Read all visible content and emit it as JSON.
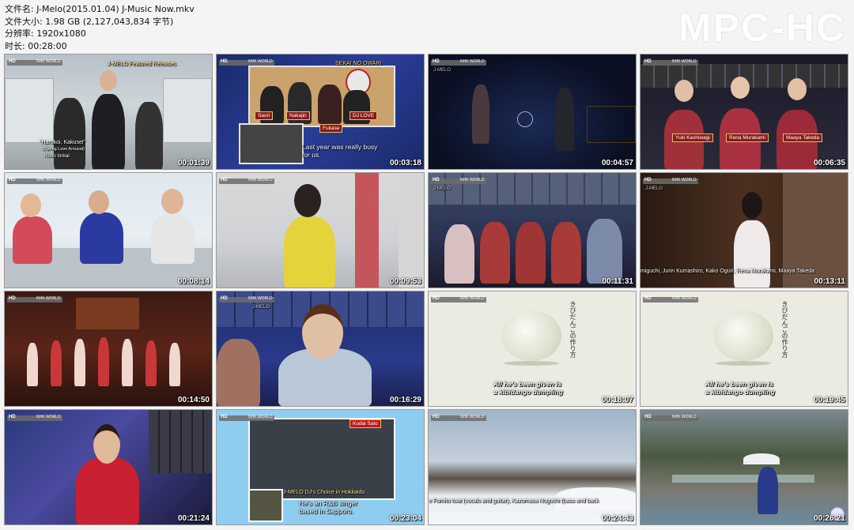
{
  "file_info": {
    "filename": "文件名: J-Melo(2015.01.04) J-Music Now.mkv",
    "filesize": "文件大小: 1.98 GB (2,127,043,834 字节)",
    "resolution": "分辨率: 1920x1080",
    "duration": "时长: 00:28:00"
  },
  "watermark": "MPC-HC",
  "thumbnails": [
    {
      "time": "00:01:39",
      "hd": "HD",
      "net": "NHK WORLD",
      "top_caption": "J-MELO Featured Releases",
      "captions": [
        "\"Harukoi, Kakusei\"",
        "(Spring Love Arousal)",
        "Kuso Iinkai"
      ]
    },
    {
      "time": "00:03:18",
      "hd": "HD",
      "net": "NHK WORLD",
      "top_caption": "SEKAI NO OWARI",
      "names": [
        "Saori",
        "Nakajin",
        "Fukase",
        "DJ LOVE"
      ],
      "captions": [
        "Last year was really busy",
        "for us."
      ]
    },
    {
      "time": "00:04:57",
      "hd": "HD",
      "net": "NHK WORLD",
      "top_caption": "J-MELO"
    },
    {
      "time": "00:06:35",
      "hd": "HD",
      "net": "NHK WORLD",
      "names": [
        "Yuki Kashiwagi",
        "Rena Murakami",
        "Maaya Takeda"
      ]
    },
    {
      "time": "00:08:14",
      "hd": "HD",
      "net": "NHK WORLD"
    },
    {
      "time": "00:09:53",
      "hd": "HD",
      "net": "NHK WORLD"
    },
    {
      "time": "00:11:31",
      "hd": "HD",
      "net": "NHK WORLD",
      "top_caption": "J-MELO"
    },
    {
      "time": "00:13:11",
      "hd": "HD",
      "net": "NHK WORLD",
      "top_caption": "J-MELO",
      "captions": [
        "miguchi, Jurin Kumashiro, Kako Oguri, Rena Murakami, Maaya Takeda"
      ]
    },
    {
      "time": "00:14:50",
      "hd": "HD",
      "net": "NHK WORLD"
    },
    {
      "time": "00:16:29",
      "hd": "HD",
      "net": "NHK WORLD",
      "top_caption": "J-MELO"
    },
    {
      "time": "00:18:07",
      "hd": "HD",
      "net": "NHK WORLD",
      "vertical": "きびだんごの作り方",
      "captions": [
        "All he's been given is",
        "a kibidango dumpling"
      ]
    },
    {
      "time": "00:19:45",
      "hd": "HD",
      "net": "NHK WORLD",
      "vertical": "きびだんごの作り方",
      "captions": [
        "All he's been given is",
        "a kibidango dumpling"
      ]
    },
    {
      "time": "00:21:24",
      "hd": "HD",
      "net": "NHK WORLD"
    },
    {
      "time": "00:23:04",
      "hd": "HD",
      "net": "NHK WORLD",
      "top_caption": "Kodai Sato",
      "captions": [
        "J-MELO DJ's Choice in Hokkaido",
        "He's an R&B singer",
        "based in Sapporo."
      ]
    },
    {
      "time": "00:24:43",
      "hd": "HD",
      "net": "NHK WORLD",
      "captions": [
        "e Fumito Iwai (vocals and guitar), Kazumasa Noguchi (bass and back"
      ]
    },
    {
      "time": "00:26:21",
      "hd": "HD",
      "net": "NHK WORLD"
    }
  ],
  "colors": {
    "timestamp": "#ffffff",
    "background": "#f4f4f4",
    "caption_red": "#8b1a1a"
  }
}
